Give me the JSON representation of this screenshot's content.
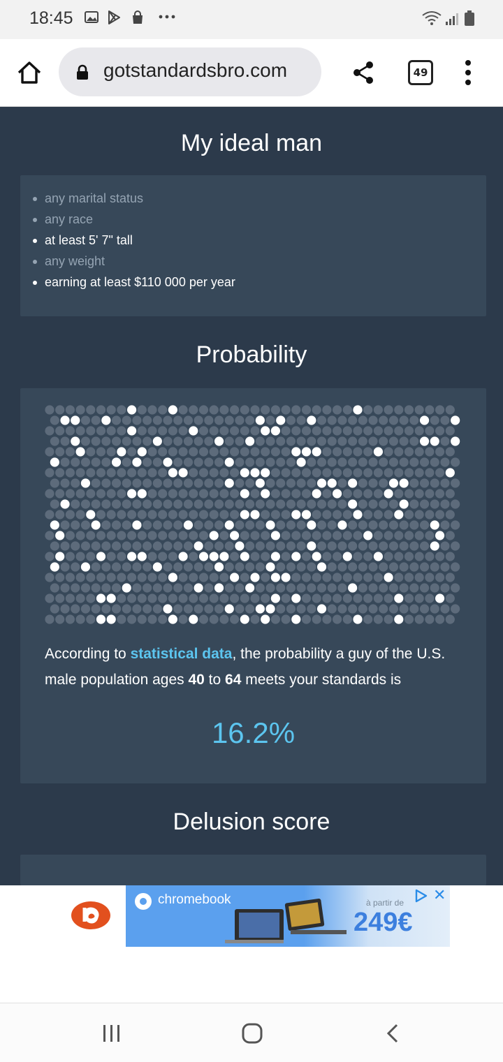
{
  "status_bar": {
    "time": "18:45"
  },
  "browser": {
    "url": "gotstandardsbro.com",
    "tab_count": "49"
  },
  "ideal_man": {
    "title": "My ideal man",
    "criteria": [
      {
        "text": "any marital status",
        "active": false
      },
      {
        "text": "any race",
        "active": false
      },
      {
        "text": "at least 5' 7\" tall",
        "active": true
      },
      {
        "text": "any weight",
        "active": false
      },
      {
        "text": "earning at least $110 000 per year",
        "active": true
      }
    ]
  },
  "probability": {
    "title": "Probability",
    "grid": {
      "rows": 21,
      "cols": 40,
      "highlighted_fraction": 0.162
    },
    "desc_pre": "According to ",
    "desc_link": "statistical data",
    "desc_mid1": ", the probability a guy of the U.S. male population ages ",
    "age_min": "40",
    "desc_mid2": " to ",
    "age_max": "64",
    "desc_post": " meets your standards is",
    "value": "16.2%"
  },
  "delusion": {
    "title": "Delusion score"
  },
  "ad": {
    "brand": "chromebook",
    "from_label": "à partir de",
    "price": "249€"
  },
  "colors": {
    "page_bg": "#2c3a4b",
    "card_bg": "#374859",
    "accent": "#5cc5ef",
    "dot_off": "#5d6b7b",
    "dot_on": "#ffffff"
  }
}
